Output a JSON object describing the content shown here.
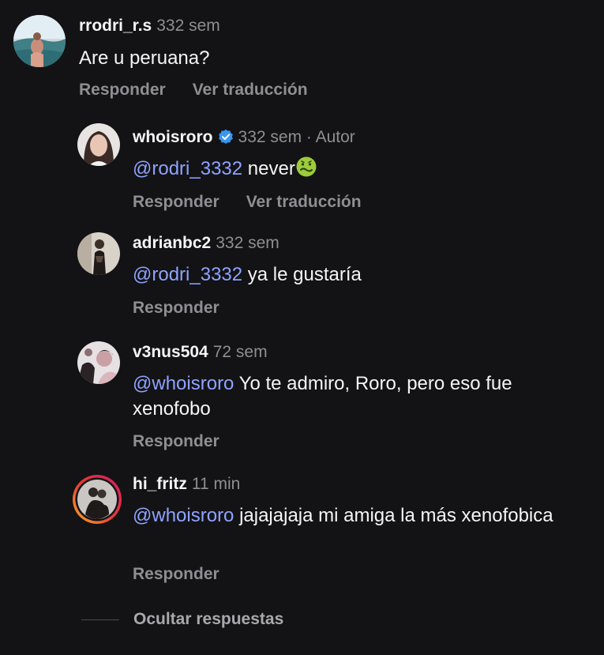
{
  "colors": {
    "background": "#131316",
    "text": "#f5f5f5",
    "muted": "#8e8e93",
    "mention": "#8fa3ff",
    "verified_badge": "#3897f0",
    "story_ring_start": "#f9a825",
    "story_ring_end": "#d81b60"
  },
  "comments": [
    {
      "username": "rrodri_r.s",
      "time": "332 sem",
      "text": "Are u peruana?",
      "reply_label": "Responder",
      "translate_label": "Ver traducción"
    },
    {
      "username": "whoisroro",
      "verified": true,
      "time": "332 sem",
      "author_tag": "· Autor",
      "mention": "@rodri_3332",
      "text": " never",
      "emoji": "nauseated-face-icon",
      "reply_label": "Responder",
      "translate_label": "Ver traducción"
    },
    {
      "username": "adrianbc2",
      "time": "332 sem",
      "mention": "@rodri_3332",
      "text": " ya le gustaría",
      "reply_label": "Responder"
    },
    {
      "username": "v3nus504",
      "time": "72 sem",
      "mention": "@whoisroro",
      "text": " Yo te admiro, Roro, pero eso fue xenofobo",
      "reply_label": "Responder"
    },
    {
      "username": "hi_fritz",
      "time": "11 min",
      "mention": "@whoisroro",
      "text": " jajajajaja mi amiga la más xenofobica",
      "reply_label": "Responder",
      "has_story_ring": true
    }
  ],
  "hide_replies_label": "Ocultar respuestas"
}
